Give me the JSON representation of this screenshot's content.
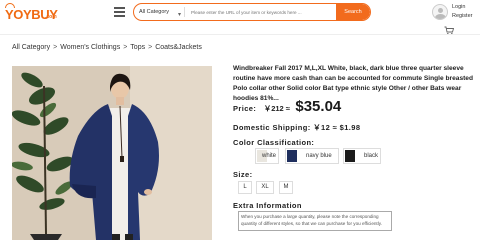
{
  "header": {
    "logo_main": "YOYBUY",
    "logo_sub": ".com",
    "category_select": "All Category",
    "search_placeholder": "Please enter the URL of your item or keywords here ...",
    "search_button": "Search",
    "login": "Login",
    "register": "Register"
  },
  "breadcrumb": [
    "All Category",
    "Women's Clothings",
    "Tops",
    "Coats&Jackets"
  ],
  "breadcrumb_separator": ">",
  "product": {
    "title": "Windbreaker Fall 2017 M,L,XL White, black, dark blue three quarter sleeve routine have more cash than can be accounted for commute Single breasted Polo collar other Solid color Bat type ethnic style Other / other Bats wear hoodies 81%...",
    "price_label": "Price:",
    "price_cny": "￥212 ≈",
    "price_usd": "$35.04",
    "shipping": "Domestic Shipping: ￥12 ≈ $1.98",
    "color_label": "Color Classification:",
    "colors": [
      {
        "name": "white",
        "swatch": "#e9e6df"
      },
      {
        "name": "navy blue",
        "swatch": "#1f2f5e"
      },
      {
        "name": "black",
        "swatch": "#1b1b1b"
      }
    ],
    "size_label": "Size:",
    "sizes": [
      "L",
      "XL",
      "M"
    ],
    "extra_label": "Extra Information",
    "extra_text": "When you purchase a large quantity, please note the corresponding quantity of different styles, so that we can purchase for you efficiently."
  },
  "colors": {
    "accent": "#f26b1d",
    "logo": "#f06a12"
  },
  "icons": {
    "menu": "hamburger-icon",
    "avatar": "user-avatar-icon",
    "cart": "cart-icon"
  }
}
